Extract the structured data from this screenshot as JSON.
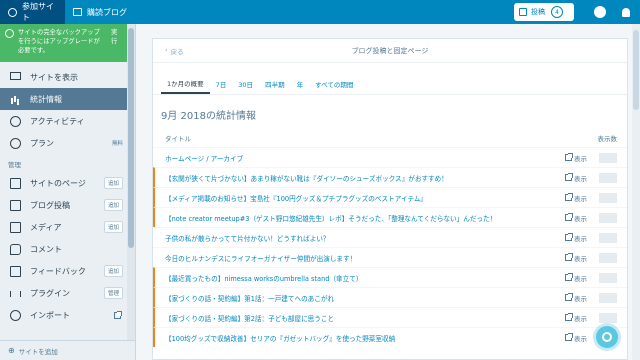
{
  "masterbar": {
    "my_site": "参加サイト",
    "reader": "購読ブログ",
    "write_label": "投稿",
    "write_count": "4"
  },
  "sidebar": {
    "notice": "サイトの完全なバックアップを行うにはアップグレードが必要です。",
    "notice_action": "実行",
    "view_site": "サイトを表示",
    "stats": "統計情報",
    "activity": "アクティビティ",
    "plan": "プラン",
    "plan_badge": "無料",
    "section_manage": "管理",
    "items": [
      {
        "label": "サイトのページ",
        "badge": "追加",
        "icon": "page-icon"
      },
      {
        "label": "ブログ投稿",
        "badge": "追加",
        "icon": "posts-icon"
      },
      {
        "label": "メディア",
        "badge": "追加",
        "icon": "media-icon"
      },
      {
        "label": "コメント",
        "badge": "",
        "icon": "comment-icon"
      },
      {
        "label": "フィードバック",
        "badge": "追加",
        "icon": "feedback-icon"
      },
      {
        "label": "プラグイン",
        "badge": "管理",
        "icon": "plugin-icon"
      },
      {
        "label": "インポート",
        "badge": "",
        "icon": "import-icon"
      }
    ],
    "footer": "サイトを追加"
  },
  "main": {
    "back": "戻る",
    "title": "ブログ投稿と固定ページ",
    "tabs": [
      "1か月の概要",
      "7日",
      "30日",
      "四半期",
      "年",
      "すべての期間"
    ],
    "stats_title": "9月 2018の統計情報",
    "col_title": "タイトル",
    "col_views": "表示数",
    "open_label": "表示",
    "rows": [
      {
        "title": "ホームページ / アーカイブ",
        "highlight": false
      },
      {
        "title": "【玄関が狭くて片づかない】あまり稼がない靴は『ダイソーのシューズボックス』がおすすめ！",
        "highlight": true
      },
      {
        "title": "【メディア掲載のお知らせ】宝島社『100円グッズ＆プチプラグッズのベストアイテム』",
        "highlight": true
      },
      {
        "title": "【note creator meetup#3（ゲスト野口悠紀雄先生）レポ】そうだった、「整理なんてくだらない」んだった！",
        "highlight": true
      },
      {
        "title": "子供の私が散らかってて片付かない！どうすればよい？",
        "highlight": false
      },
      {
        "title": "今日のヒルナンデスにライフオーガナイザー仲間が出演します！",
        "highlight": false
      },
      {
        "title": "【最近買ったもの】nimessa worksのumbrella stand（傘立て）",
        "highlight": true
      },
      {
        "title": "【家づくりの話・契約編】第1話：一戸建てへのあこがれ",
        "highlight": true
      },
      {
        "title": "【家づくりの話・契約編】第2話：子ども部屋に思うこと",
        "highlight": true
      },
      {
        "title": "【100均グッズで収納改善】セリアの『ガゼットバッグ』を使った野菜室収納",
        "highlight": true
      }
    ]
  },
  "colors": {
    "masterbar": "#0087be",
    "masterbar_active": "#005082",
    "sidebar_selected": "#537994",
    "notice": "#4ab866",
    "link": "#0087be",
    "highlight_border": "#f0821e"
  }
}
